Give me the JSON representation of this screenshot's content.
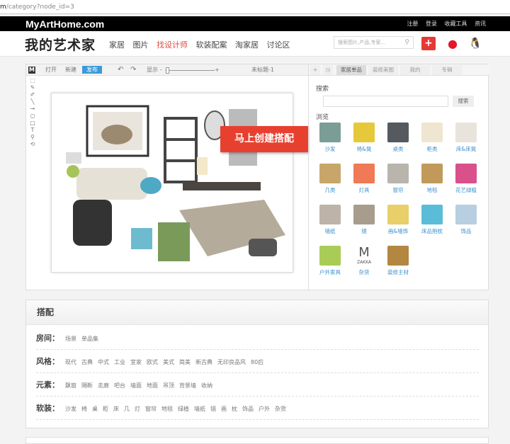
{
  "address": {
    "host_tail": "m",
    "path": "/category?node_id=3"
  },
  "topbar": {
    "logo": "MyArtHome.com",
    "links": [
      "注册",
      "登录",
      "收藏工具",
      "资讯"
    ]
  },
  "nav": {
    "brand": "我的艺术家",
    "items": [
      "家居",
      "图片",
      "找设计师",
      "软装配案",
      "淘家居",
      "讨论区"
    ],
    "active": 2,
    "search_placeholder": "搜索图片,产品,专家...",
    "plus": "+"
  },
  "editor": {
    "toolbar": {
      "logo": "M",
      "open": "打开",
      "new": "新建",
      "publish": "发布",
      "undo": "↶",
      "redo": "↷",
      "zoom_label": "显示",
      "minus": "-",
      "plus": "+",
      "doc_title": "未标题-1"
    },
    "tools": [
      "⬚",
      "✎",
      "✐",
      "╲",
      "→",
      "○",
      "□",
      "T",
      "⚲",
      "⟲"
    ],
    "cta": "马上创建搭配"
  },
  "right": {
    "tabs": [
      "家居单品",
      "装修美图",
      "我的",
      "专辑"
    ],
    "search_label": "搜索",
    "search_button": "搜索",
    "browse_label": "浏览",
    "categories": [
      {
        "label": "沙发",
        "color": "#7a9e96"
      },
      {
        "label": "椅&凳",
        "color": "#e6c93a"
      },
      {
        "label": "桌类",
        "color": "#555a60"
      },
      {
        "label": "柜类",
        "color": "#efe6d2"
      },
      {
        "label": "床&床凳",
        "color": "#e8e4dc"
      },
      {
        "label": "几类",
        "color": "#c8a66a"
      },
      {
        "label": "灯具",
        "color": "#ef7a55"
      },
      {
        "label": "窗帘",
        "color": "#b9b5ad"
      },
      {
        "label": "地毯",
        "color": "#c19a5b"
      },
      {
        "label": "花艺绿植",
        "color": "#d9508a"
      },
      {
        "label": "墙纸",
        "color": "#bdb3a8"
      },
      {
        "label": "镜",
        "color": "#a89c8c"
      },
      {
        "label": "画&墙饰",
        "color": "#e8cf6a"
      },
      {
        "label": "床品抱枕",
        "color": "#5bbcd9"
      },
      {
        "label": "饰品",
        "color": "#b7cfe0"
      },
      {
        "label": "户外家具",
        "color": "#a8cc56"
      },
      {
        "label": "杂货",
        "color": "#ffffff",
        "mark": "M",
        "sub": "ZAKKA"
      },
      {
        "label": "装修主材",
        "color": "#b38642"
      }
    ]
  },
  "filters": {
    "title": "搭配",
    "rows": [
      {
        "key": "房间：",
        "values": [
          "场景",
          "单品集"
        ]
      },
      {
        "key": "风格：",
        "values": [
          "现代",
          "古典",
          "中式",
          "工业",
          "宜家",
          "欧式",
          "美式",
          "简美",
          "新古典",
          "无印良品风",
          "80后"
        ]
      },
      {
        "key": "元素：",
        "values": [
          "飘窗",
          "隔断",
          "走廊",
          "吧台",
          "墙面",
          "地面",
          "吊顶",
          "背景墙",
          "收纳"
        ]
      },
      {
        "key": "软装：",
        "values": [
          "沙发",
          "椅",
          "桌",
          "柜",
          "床",
          "几",
          "灯",
          "窗帘",
          "地毯",
          "绿植",
          "墙纸",
          "镜",
          "画",
          "枕",
          "饰品",
          "户外",
          "杂货"
        ]
      }
    ]
  }
}
